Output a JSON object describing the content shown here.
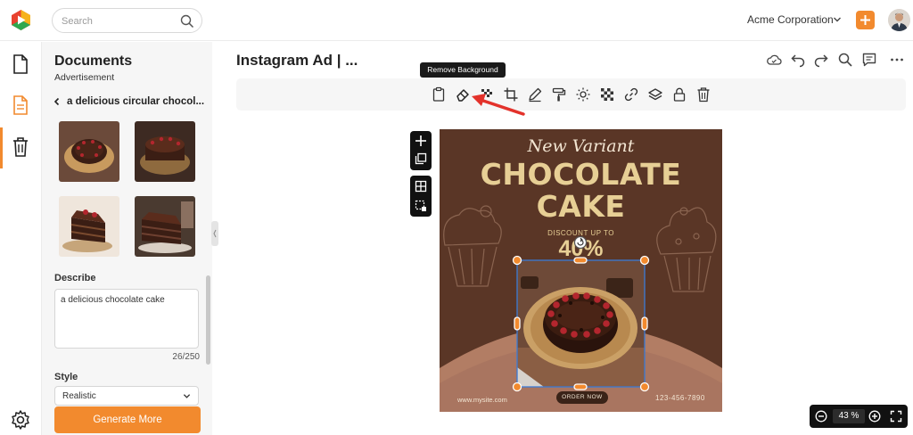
{
  "app": {
    "org_name": "Acme Corporation",
    "search_placeholder": "Search",
    "brand_colors": {
      "accent": "#f28a2e",
      "selection": "#3b7bd6"
    }
  },
  "panel": {
    "title": "Documents",
    "subtitle": "Advertisement",
    "back_label": "a delicious circular chocol...",
    "thumbnails": [
      "cake-top-view",
      "cake-top-view-2",
      "cake-slice",
      "cake-slice-2"
    ],
    "describe_label": "Describe",
    "describe_value": "a delicious chocolate cake",
    "describe_counter": "26/250",
    "style_label": "Style",
    "style_value": "Realistic",
    "generate_label": "Generate More"
  },
  "editor": {
    "doc_title": "Instagram Ad | ...",
    "tooltip": "Remove Background",
    "toolbar_icons": [
      "clipboard-icon",
      "eraser-icon",
      "transparency-icon",
      "crop-icon",
      "pen-icon",
      "paint-roller-icon",
      "brightness-icon",
      "pattern-icon",
      "link-icon",
      "layers-icon",
      "lock-icon",
      "trash-icon"
    ],
    "top_action_icons": [
      "cloud-icon",
      "undo-icon",
      "redo-icon",
      "search-icon",
      "comment-icon",
      "more-icon"
    ],
    "zoom_value": "43 %"
  },
  "ad": {
    "headline_script": "New Variant",
    "headline_1": "CHOCOLATE",
    "headline_2": "CAKE",
    "discount_label": "DISCOUNT UP TO",
    "discount_value": "40%",
    "website": "www.mysite.com",
    "cta": "ORDER NOW",
    "phone": "123-456-7890"
  }
}
